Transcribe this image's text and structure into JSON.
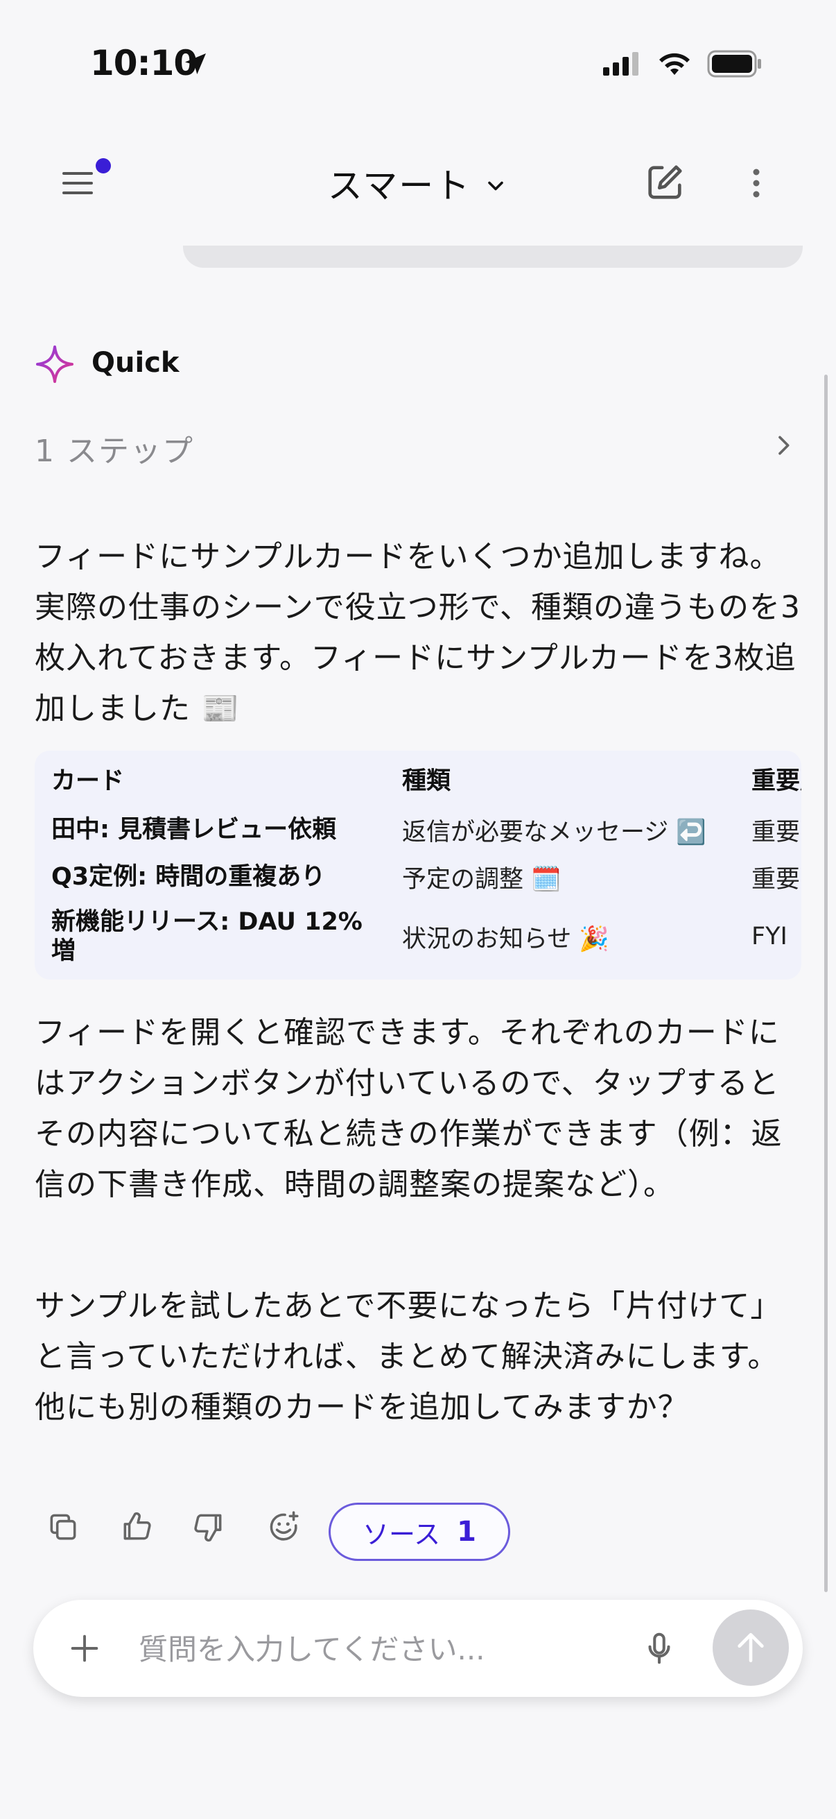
{
  "status_bar": {
    "time": "10:10",
    "icons": [
      "location-arrow-icon",
      "cellular-signal-icon",
      "wifi-icon",
      "battery-icon"
    ]
  },
  "header": {
    "title": "スマート",
    "chevron": "▾",
    "badge_color": "#3a1ed6"
  },
  "assistant": {
    "label": "Quick",
    "steps_label": "1 ステップ"
  },
  "message": {
    "paragraph1": "フィードにサンプルカードをいくつか追加しますね。実際の仕事のシーンで役立つ形で、種類の違うものを3枚入れておきます。フィードにサンプルカードを3枚追加しました 📰",
    "paragraph2": "フィードを開くと確認できます。それぞれのカードにはアクションボタンが付いているので、タップするとその内容について私と続きの作業ができます（例：返信の下書き作成、時間の調整案の提案など）。",
    "paragraph3": "サンプルを試したあとで不要になったら「片付けて」と言っていただければ、まとめて解決済みにします。他にも別の種類のカードを追加してみますか？"
  },
  "table": {
    "headers": [
      "カード",
      "種類",
      "重要度"
    ],
    "rows": [
      [
        "田中: 見積書レビュー依頼",
        "返信が必要なメッセージ ↩️",
        "重要"
      ],
      [
        "Q3定例: 時間の重複あり",
        "予定の調整 🗓️",
        "重要"
      ],
      [
        "新機能リリース: DAU 12%増",
        "状況のお知らせ 🎉",
        "FYI"
      ]
    ]
  },
  "actions": {
    "source_label": "ソース",
    "source_count": "1"
  },
  "input": {
    "placeholder": "質問を入力してください..."
  },
  "colors": {
    "accent": "#3a1ed6",
    "background": "#f7f7f9",
    "table_bg": "#f1f2fb",
    "sparkle_start": "#8a3ce0",
    "sparkle_end": "#e0368c"
  }
}
